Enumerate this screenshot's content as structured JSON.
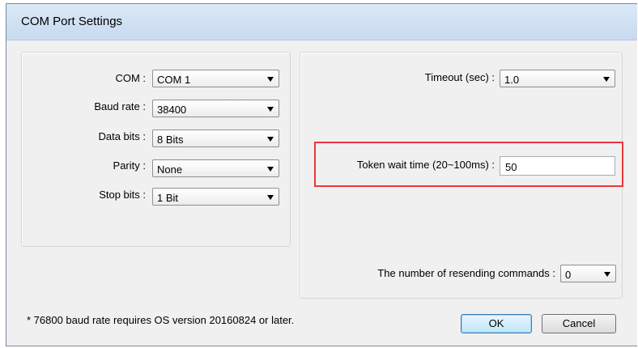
{
  "window": {
    "title": "COM Port Settings"
  },
  "com_panel": {
    "fields": [
      {
        "label": "COM :",
        "value": "COM 1"
      },
      {
        "label": "Baud rate :",
        "value": "38400"
      },
      {
        "label": "Data bits :",
        "value": "8 Bits"
      },
      {
        "label": "Parity :",
        "value": "None"
      },
      {
        "label": "Stop bits :",
        "value": "1 Bit"
      }
    ]
  },
  "timing_panel": {
    "timeout_label": "Timeout (sec) :",
    "timeout_value": "1.0",
    "token_wait_label": "Token wait time (20~100ms) :",
    "token_wait_value": "50",
    "resend_label": "The number of resending commands :",
    "resend_value": "0"
  },
  "footnote": "* 76800 baud rate requires OS version 20160824 or later.",
  "buttons": {
    "ok": "OK",
    "cancel": "Cancel"
  },
  "colors": {
    "highlight": "#e8393c",
    "title_bar": "#c8daf0",
    "dialog_bg": "#f0f0f0"
  }
}
